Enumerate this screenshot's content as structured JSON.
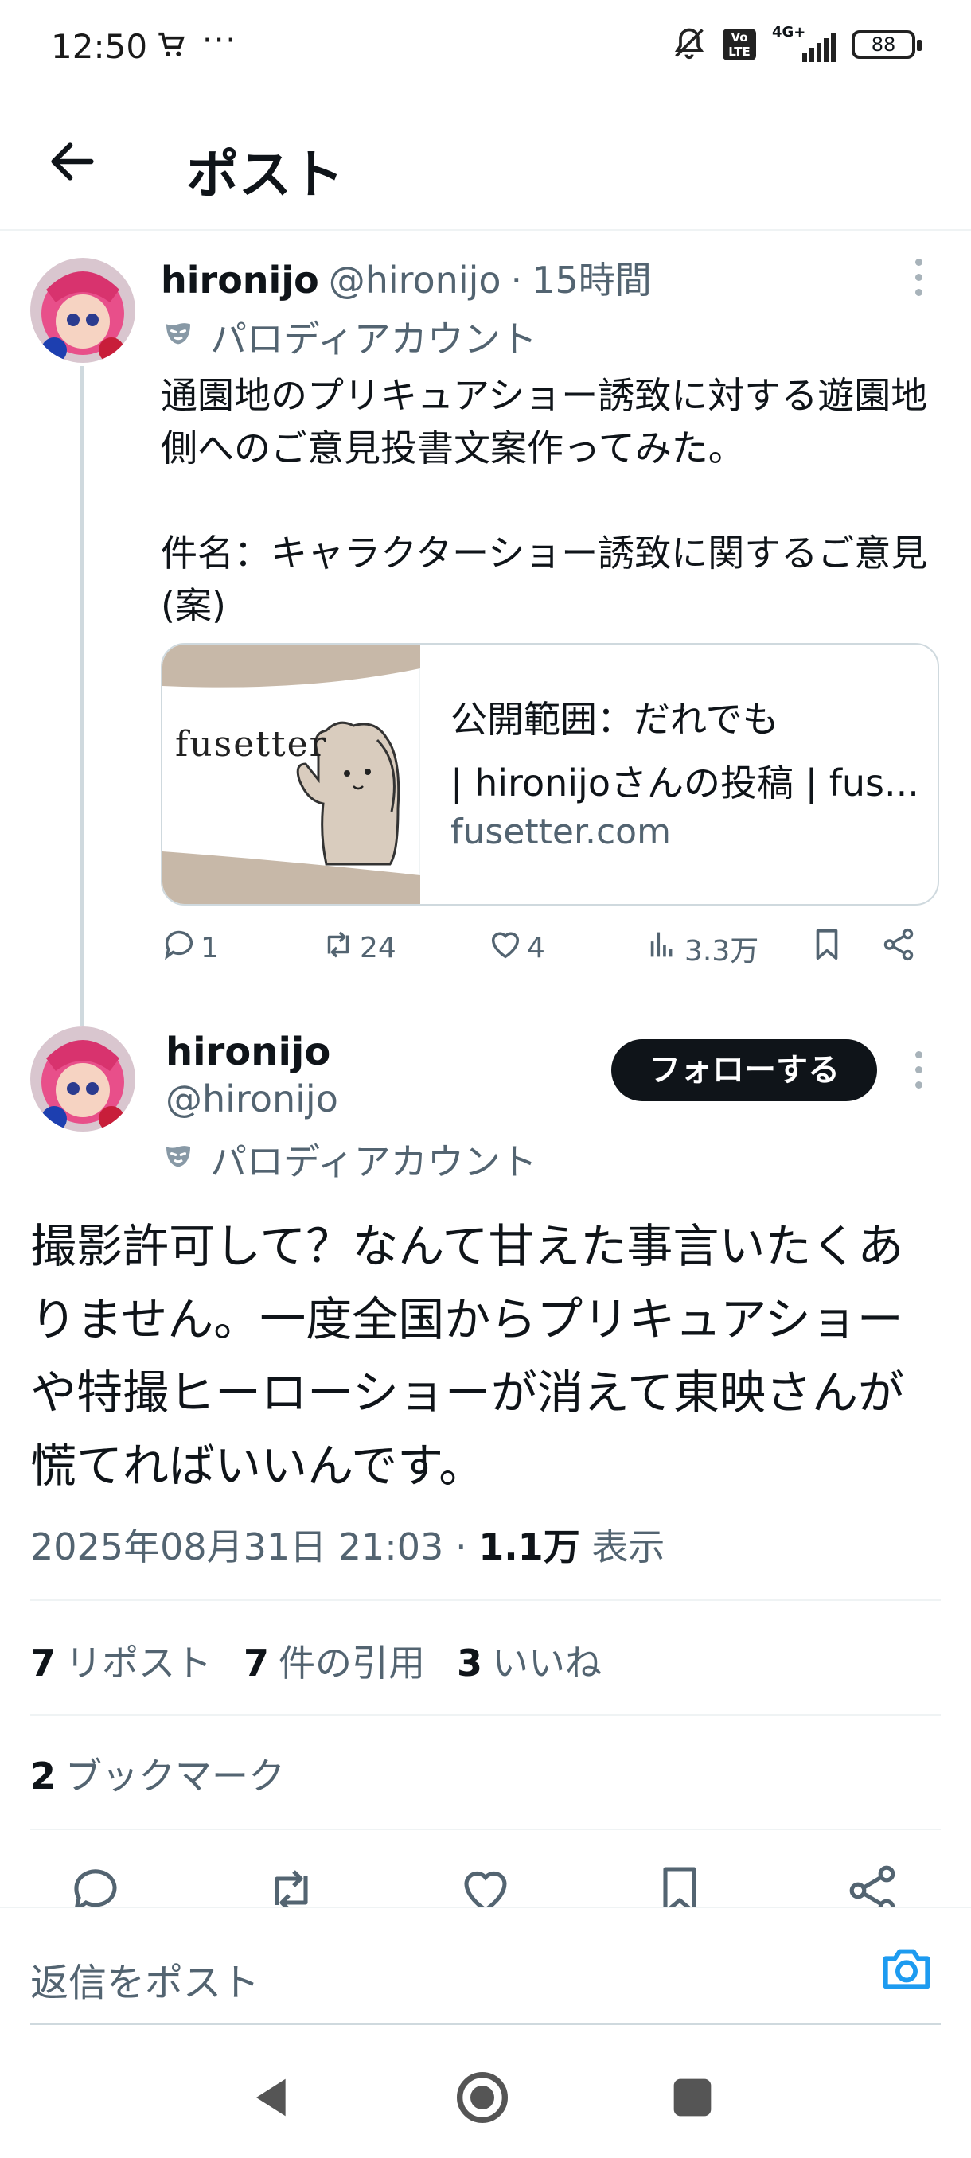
{
  "status_bar": {
    "time": "12:50",
    "dots": "···",
    "network": "4G+",
    "volte": "Vo LTE",
    "battery": "88"
  },
  "header": {
    "title": "ポスト"
  },
  "tweet1": {
    "name": "hironijo",
    "handle": "@hironijo",
    "separator": "·",
    "time_ago": "15時間",
    "parody_label": "パロディアカウント",
    "text": "通園地のプリキュアショー誘致に対する遊園地側へのご意見投書文案作ってみた。\n\n件名：キャラクターショー誘致に関するご意見(案)",
    "link_card": {
      "thumb_text": "fusetter",
      "title": "公開範囲：だれでも",
      "subtitle": "| hironijoさんの投稿 | fus...",
      "domain": "fusetter.com"
    },
    "actions": {
      "replies": "1",
      "reposts": "24",
      "likes": "4",
      "views": "3.3万"
    }
  },
  "tweet2": {
    "name": "hironijo",
    "handle": "@hironijo",
    "follow_label": "フォローする",
    "parody_label": "パロディアカウント",
    "text": "撮影許可して？なんて甘えた事言いたくありません。一度全国からプリキュアショーや特撮ヒーローショーが消えて東映さんが慌てればいいんです。",
    "timestamp": "2025年08月31日 21:03",
    "separator": "·",
    "views_count": "1.1万",
    "views_label": "表示",
    "stats": {
      "reposts_count": "7",
      "reposts_label": "リポスト",
      "quotes_count": "7",
      "quotes_label": "件の引用",
      "likes_count": "3",
      "likes_label": "いいね",
      "bookmarks_count": "2",
      "bookmarks_label": "ブックマーク"
    }
  },
  "reply": {
    "placeholder": "返信をポスト"
  },
  "colors": {
    "text_primary": "#0f1419",
    "text_secondary": "#536471",
    "accent": "#1d9bf0",
    "border": "#eff3f4"
  },
  "icons": [
    "back-arrow-icon",
    "cart-icon",
    "mute-bell-icon",
    "signal-icon",
    "battery-icon",
    "mask-icon",
    "more-icon",
    "reply-icon",
    "repost-icon",
    "like-icon",
    "views-icon",
    "bookmark-icon",
    "share-icon",
    "camera-icon",
    "nav-back-icon",
    "nav-home-icon",
    "nav-recents-icon"
  ]
}
